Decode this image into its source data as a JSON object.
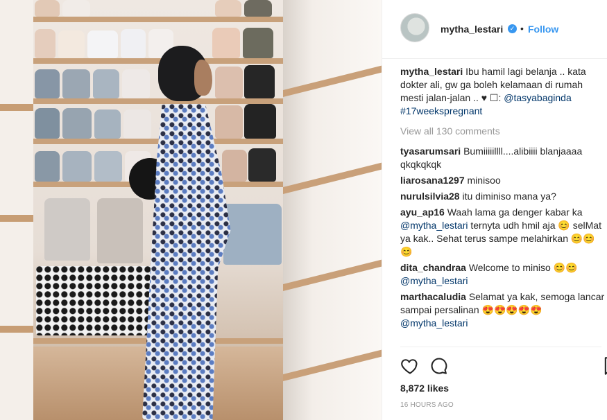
{
  "post": {
    "username": "mytha_lestari",
    "verified_symbol": "✓",
    "separator": "•",
    "follow_label": "Follow",
    "caption_user": "mytha_lestari",
    "caption_text": "Ibu hamil lagi belanja .. kata dokter ali, gw ga boleh kelamaan di rumah mesti jalan-jalan .. ♥ ☐:",
    "caption_mention": "@tasyabaginda",
    "caption_hashtag": "#17weekspregnant",
    "view_all": "View all 130 comments",
    "likes": "8,872 likes",
    "time": "16 HOURS AGO"
  },
  "comments": [
    {
      "user": "tyasarumsari",
      "text": "Bumiiiiillll....alibiiii blanjaaaa qkqkqkqk",
      "mention": ""
    },
    {
      "user": "liarosana1297",
      "text": "minisoo",
      "mention": ""
    },
    {
      "user": "nurulsilvia28",
      "text": "itu diminiso mana ya?",
      "mention": ""
    },
    {
      "user": "ayu_ap16",
      "text": "Waah lama ga denger kabar ka",
      "mention": "@mytha_lestari",
      "after": "ternyta udh hmil aja 😊 selMat ya kak.. Sehat terus sampe melahirkan 😊😊😊"
    },
    {
      "user": "dita_chandraa",
      "text": "Welcome to miniso 😊😊",
      "mention": "@mytha_lestari"
    },
    {
      "user": "marthacaludia",
      "text": "Selamat ya kak, semoga lancar sampai persalinan 😍😍😍😍😍",
      "mention": "@mytha_lestari"
    }
  ],
  "icons": [
    "heart-icon",
    "comment-icon",
    "save-icon",
    "verified-badge-icon"
  ],
  "colors": {
    "accent": "#3897f0",
    "mention": "#003569",
    "muted": "#999999"
  }
}
